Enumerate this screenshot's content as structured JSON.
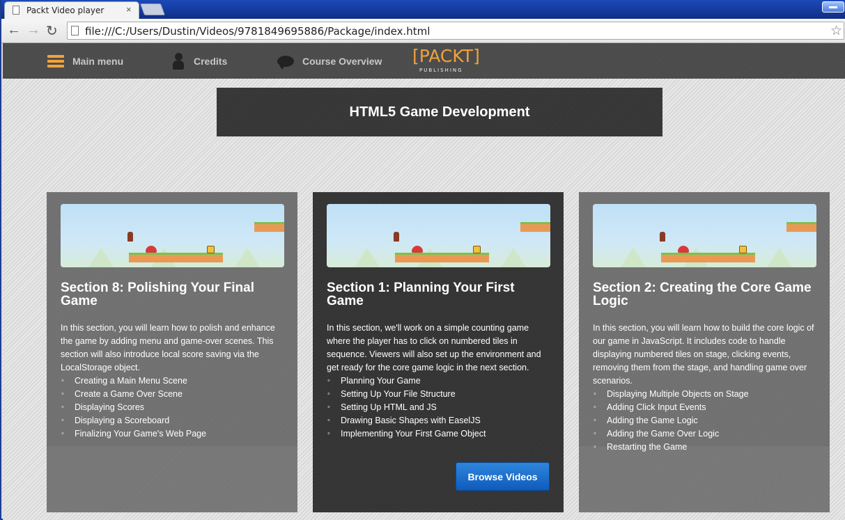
{
  "browser": {
    "tab_title": "Packt Video player",
    "tab_close": "×",
    "url": "file:///C:/Users/Dustin/Videos/9781849695886/Package/index.html",
    "back": "←",
    "forward": "→",
    "reload": "↻",
    "star": "☆"
  },
  "nav": {
    "items": [
      {
        "label": "Main menu",
        "icon": "menu-icon"
      },
      {
        "label": "Credits",
        "icon": "person-icon"
      },
      {
        "label": "Course Overview",
        "icon": "speech-bubble-icon"
      }
    ],
    "logo": {
      "word": "[PACKT]",
      "sub": "PUBLISHING"
    },
    "accent": "#f0a23a"
  },
  "header": {
    "title": "HTML5 Game Development"
  },
  "cards": [
    {
      "title": "Section 8: Polishing Your Final Game",
      "description": "In this section, you will learn how to polish and enhance the game by adding menu and game-over scenes. This section will also introduce local score saving via the LocalStorage object.",
      "items": [
        "Creating a Main Menu Scene",
        "Create a Game Over Scene",
        "Displaying Scores",
        "Displaying a Scoreboard",
        "Finalizing Your Game's Web Page"
      ]
    },
    {
      "title": "Section 1: Planning Your First Game",
      "description": "In this section, we'll work on a simple counting game where the player has to click on numbered tiles in sequence. Viewers will also set up the environment and get ready for the core game logic in the next section.",
      "items": [
        "Planning Your Game",
        "Setting Up Your File Structure",
        "Setting Up HTML and JS",
        "Drawing Basic Shapes with EaselJS",
        "Implementing Your First Game Object"
      ],
      "button": "Browse Videos"
    },
    {
      "title": "Section 2: Creating the Core Game Logic",
      "description": "In this section, you will learn how to build the core logic of our game in JavaScript. It includes code to handle displaying numbered tiles on stage, clicking events, removing them from the stage, and handling game over scenarios.",
      "items": [
        "Displaying Multiple Objects on Stage",
        "Adding Click Input Events",
        "Adding the Game Logic",
        "Adding the Game Over Logic",
        "Restarting the Game"
      ]
    }
  ],
  "colors": {
    "button": "#1a6fd0",
    "card_active": "#333333",
    "card_inactive": "#6f6f6f"
  }
}
